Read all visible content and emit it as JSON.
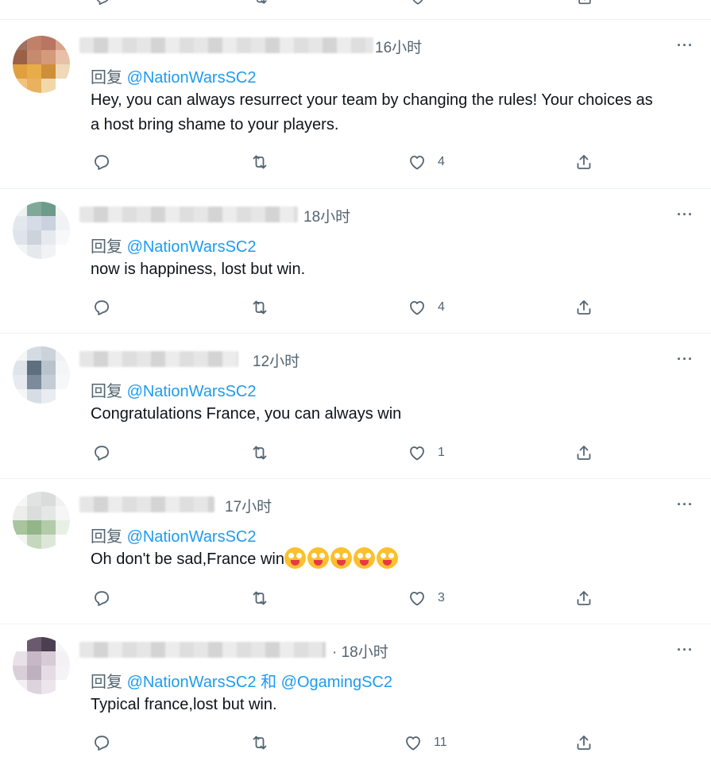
{
  "icons": {
    "reply": "reply-icon",
    "retweet": "retweet-icon",
    "like": "heart-icon",
    "share": "share-icon",
    "more": "more-icon"
  },
  "colors": {
    "link": "#1d9bf0",
    "secondary_text": "#536471",
    "divider": "#eff3f4"
  },
  "reply_prefix": "回复",
  "more_label": "···",
  "tweets": [
    {
      "time": "16小时",
      "reply_to": "@NationWarsSC2",
      "text": "Hey, you can always resurrect your team by changing the rules! Your choices as a host bring shame to your players.",
      "likes": "4"
    },
    {
      "time": "18小时",
      "reply_to": "@NationWarsSC2",
      "text": "now is happiness, lost but win.",
      "likes": "4"
    },
    {
      "time": "12小时",
      "reply_to": "@NationWarsSC2",
      "text": "Congratulations France, you can always win",
      "likes": "1"
    },
    {
      "time": "17小时",
      "reply_to": "@NationWarsSC2",
      "text": "Oh don't be sad,France win",
      "emoji_count": 5,
      "likes": "3"
    },
    {
      "time": "· 18小时",
      "reply_to": "@NationWarsSC2",
      "reply_conj": "和",
      "reply_to_2": "@OgamingSC2",
      "text": "Typical france,lost but win.",
      "likes": "11"
    }
  ]
}
